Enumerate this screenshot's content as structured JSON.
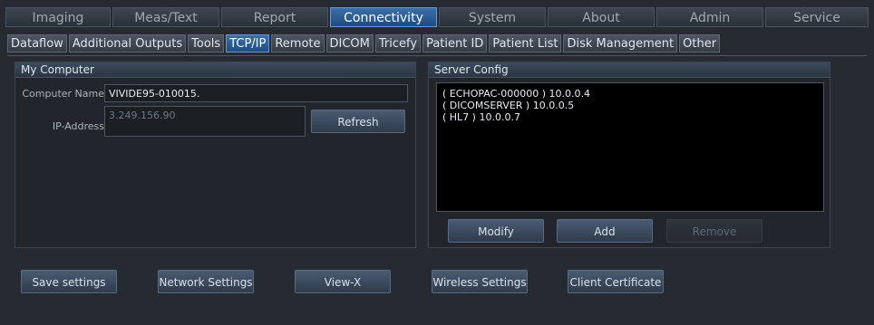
{
  "top_tabs": [
    "Imaging",
    "Meas/Text",
    "Report",
    "Connectivity",
    "System",
    "About",
    "Admin",
    "Service"
  ],
  "sub_tabs": [
    "Dataflow",
    "Additional Outputs",
    "Tools",
    "TCP/IP",
    "Remote",
    "DICOM",
    "Tricefy",
    "Patient ID",
    "Patient List",
    "Disk Management",
    "Other"
  ],
  "my_computer": {
    "title": "My Computer",
    "computer_name_label": "Computer Name",
    "computer_name_value": "VIVIDE95-010015.",
    "ip_label": "IP-Address",
    "ip_value": "3.249.156.90",
    "refresh_label": "Refresh"
  },
  "server_config": {
    "title": "Server Config",
    "entries": [
      "( ECHOPAC-000000 ) 10.0.0.4",
      "( DICOMSERVER ) 10.0.0.5",
      "( HL7 ) 10.0.0.7"
    ],
    "modify_label": "Modify",
    "add_label": "Add",
    "remove_label": "Remove"
  },
  "bottom_buttons": {
    "save_settings": "Save settings",
    "network_settings": "Network Settings",
    "view_x": "View-X",
    "wireless_settings": "Wireless Settings",
    "client_certificate": "Client Certificate"
  },
  "colors": {
    "active_tab": "#2d5e99",
    "background": "#262a31"
  }
}
